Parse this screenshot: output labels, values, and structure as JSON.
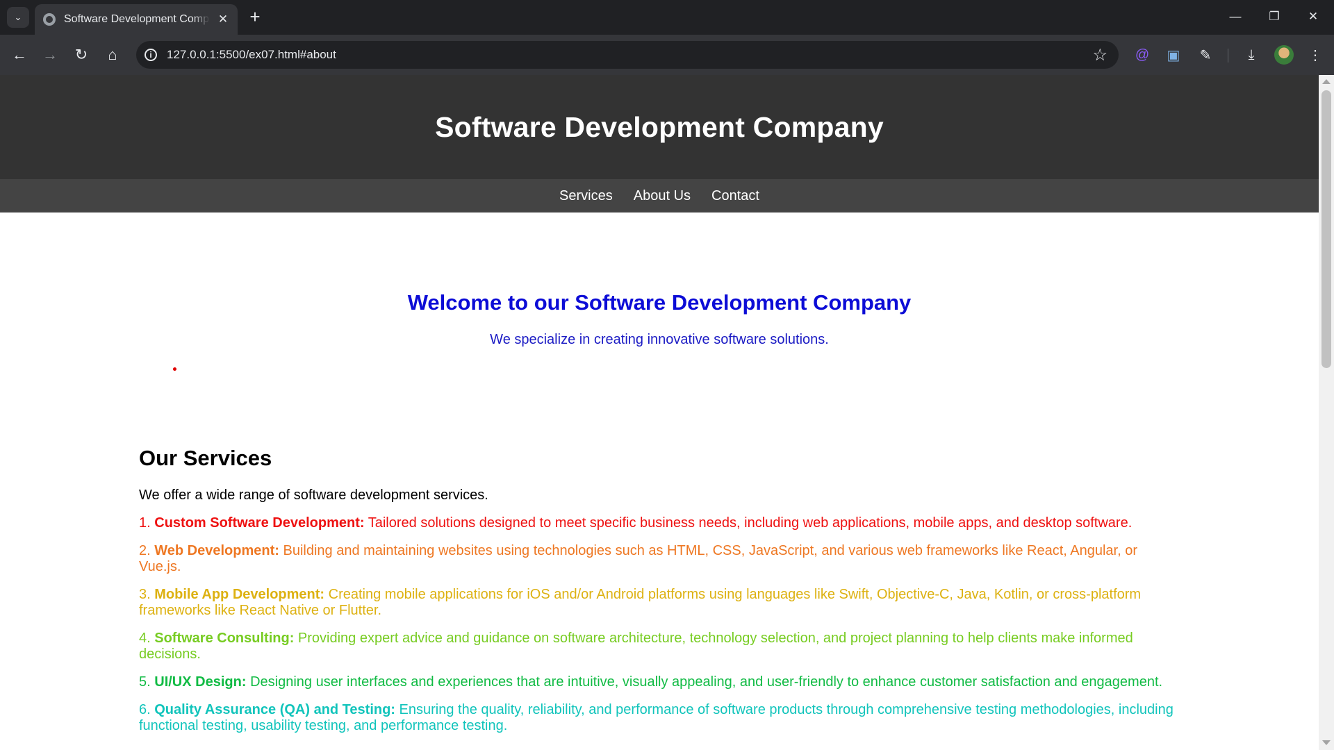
{
  "browser": {
    "tab_title": "Software Development Company",
    "url": "127.0.0.1:5500/ex07.html#about"
  },
  "site": {
    "title": "Software Development Company",
    "nav": [
      "Services",
      "About Us",
      "Contact"
    ],
    "hero": {
      "heading": "Welcome to our Software Development Company",
      "subtitle": "We specialize in creating innovative software solutions."
    },
    "services": {
      "heading": "Our Services",
      "intro": "We offer a wide range of software development services.",
      "items": [
        {
          "num": "1.",
          "title": "Custom Software Development:",
          "desc": "Tailored solutions designed to meet specific business needs, including web applications, mobile apps, and desktop software.",
          "color": "#ee1111"
        },
        {
          "num": "2.",
          "title": "Web Development:",
          "desc": "Building and maintaining websites using technologies such as HTML, CSS, JavaScript, and various web frameworks like React, Angular, or Vue.js.",
          "color": "#ee7722"
        },
        {
          "num": "3.",
          "title": "Mobile App Development:",
          "desc": "Creating mobile applications for iOS and/or Android platforms using languages like Swift, Objective-C, Java, Kotlin, or cross-platform frameworks like React Native or Flutter.",
          "color": "#ddb111"
        },
        {
          "num": "4.",
          "title": "Software Consulting:",
          "desc": "Providing expert advice and guidance on software architecture, technology selection, and project planning to help clients make informed decisions.",
          "color": "#77cc22"
        },
        {
          "num": "5.",
          "title": "UI/UX Design:",
          "desc": "Designing user interfaces and experiences that are intuitive, visually appealing, and user-friendly to enhance customer satisfaction and engagement.",
          "color": "#11bb44"
        },
        {
          "num": "6.",
          "title": "Quality Assurance (QA) and Testing:",
          "desc": "Ensuring the quality, reliability, and performance of software products through comprehensive testing methodologies, including functional testing, usability testing, and performance testing.",
          "color": "#11c4bb"
        }
      ]
    }
  }
}
